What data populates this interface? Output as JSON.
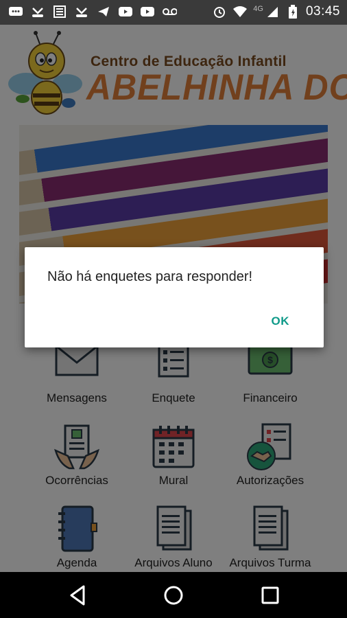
{
  "status_bar": {
    "time": "03:45",
    "network": "4G",
    "left_icons": [
      "message-icon",
      "missed-call-icon",
      "news-icon",
      "missed-call-icon",
      "telegram-icon",
      "youtube-icon",
      "youtube-icon",
      "voicemail-icon"
    ],
    "right_icons": [
      "alarm-icon",
      "wifi-icon",
      "signal-icon",
      "battery-icon"
    ]
  },
  "header": {
    "subtitle": "Centro de Educação Infantil",
    "title": "ABELHINHA DOURADA"
  },
  "menu": {
    "items": [
      {
        "label": "Mensagens",
        "icon": "envelope-icon"
      },
      {
        "label": "Enquete",
        "icon": "survey-icon"
      },
      {
        "label": "Financeiro",
        "icon": "money-icon"
      },
      {
        "label": "Ocorrências",
        "icon": "report-hands-icon"
      },
      {
        "label": "Mural",
        "icon": "calendar-icon"
      },
      {
        "label": "Autorizações",
        "icon": "handshake-checklist-icon"
      },
      {
        "label": "Agenda",
        "icon": "notebook-icon"
      },
      {
        "label": "Arquivos Aluno",
        "icon": "documents-icon"
      },
      {
        "label": "Arquivos Turma",
        "icon": "documents-icon"
      }
    ]
  },
  "dialog": {
    "message": "Não há enquetes para responder!",
    "ok_label": "OK"
  },
  "colors": {
    "accent": "#0f9a89",
    "brand_orange": "#e2813a",
    "brand_brown": "#7a4a1e"
  }
}
